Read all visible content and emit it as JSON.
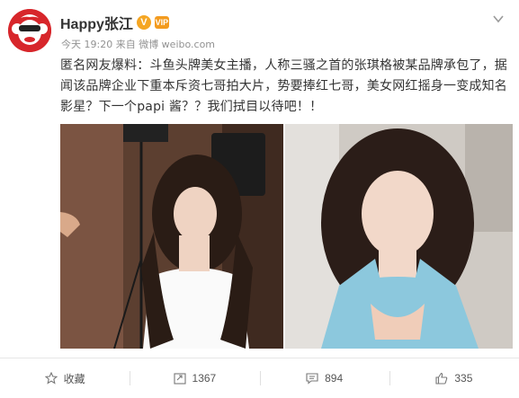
{
  "user": {
    "name": "Happy张江",
    "verified_badge": "V",
    "vip_badge": "VIP",
    "avatar_color": "#d7262b"
  },
  "post": {
    "meta": "今天 19:20 来自 微博 weibo.com",
    "text": "匿名网友爆料：斗鱼头牌美女主播，人称三骚之首的张琪格被某品牌承包了，据闻该品牌企业下重本斥资七哥拍大片，势要捧红七哥，美女网红摇身一变成知名影星？下一个papi 酱？？我们拭目以待吧！！"
  },
  "photos": [
    {
      "name": "photo-left"
    },
    {
      "name": "photo-right"
    }
  ],
  "actions": {
    "favorite": {
      "label": "收藏",
      "icon": "star-icon"
    },
    "repost": {
      "label": "1367",
      "icon": "repost-icon"
    },
    "comment": {
      "label": "894",
      "icon": "comment-icon"
    },
    "like": {
      "label": "335",
      "icon": "thumbs-up-icon"
    }
  },
  "colors": {
    "accent": "#f5a623",
    "text": "#333333",
    "meta": "#929292"
  }
}
